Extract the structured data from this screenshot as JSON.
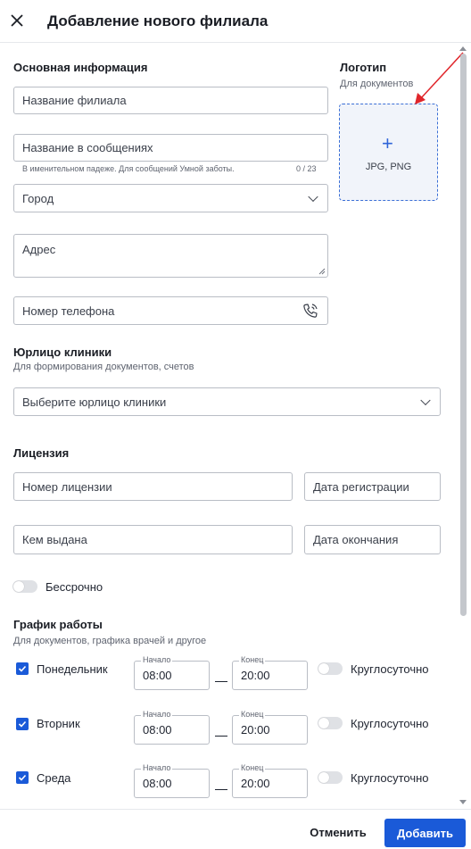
{
  "header": {
    "title": "Добавление нового филиала"
  },
  "main_info": {
    "heading": "Основная информация",
    "branch_name_placeholder": "Название филиала",
    "message_name_placeholder": "Название в сообщениях",
    "message_name_hint": "В именительном падеже. Для сообщений Умной заботы.",
    "message_name_counter": "0 / 23",
    "city_placeholder": "Город",
    "address_placeholder": "Адрес",
    "phone_placeholder": "Номер телефона"
  },
  "logo": {
    "heading": "Логотип",
    "subtitle": "Для документов",
    "plus": "+",
    "formats": "JPG, PNG"
  },
  "legal": {
    "heading": "Юрлицо клиники",
    "subtitle": "Для формирования документов, счетов",
    "select_placeholder": "Выберите юрлицо клиники"
  },
  "license": {
    "heading": "Лицензия",
    "number_placeholder": "Номер лицензии",
    "reg_date_placeholder": "Дата регистрации",
    "issued_by_placeholder": "Кем выдана",
    "expiry_date_placeholder": "Дата окончания",
    "unlimited_label": "Бессрочно",
    "unlimited_on": false
  },
  "schedule": {
    "heading": "График работы",
    "subtitle": "Для документов, графика врачей и другое",
    "start_label": "Начало",
    "end_label": "Конец",
    "dash": "—",
    "around_clock_label": "Круглосуточно",
    "days": [
      {
        "name": "Понедельник",
        "checked": true,
        "start": "08:00",
        "end": "20:00",
        "around_clock": false
      },
      {
        "name": "Вторник",
        "checked": true,
        "start": "08:00",
        "end": "20:00",
        "around_clock": false
      },
      {
        "name": "Среда",
        "checked": true,
        "start": "08:00",
        "end": "20:00",
        "around_clock": false
      }
    ]
  },
  "footer": {
    "cancel_label": "Отменить",
    "add_label": "Добавить"
  },
  "colors": {
    "accent": "#1a5ad8",
    "annotation": "#e0262b",
    "border": "#b9bdc5"
  }
}
